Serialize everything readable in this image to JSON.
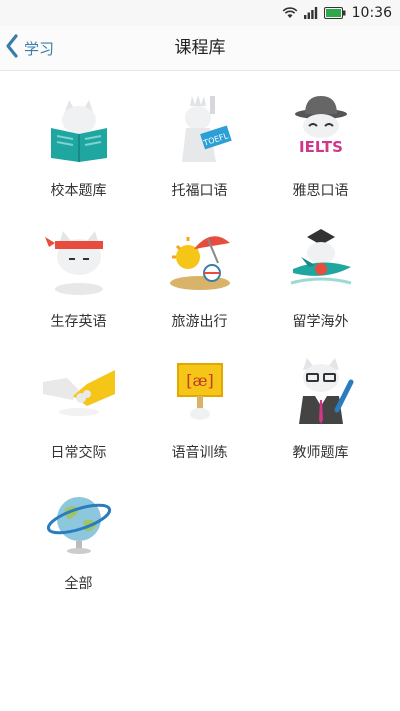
{
  "status_bar": {
    "time": "10:36"
  },
  "header": {
    "back_label": "学习",
    "title": "课程库"
  },
  "courses": [
    {
      "label": "校本题库",
      "icon": "book-cat-icon"
    },
    {
      "label": "托福口语",
      "icon": "statue-of-liberty-toefl-icon",
      "badge": "TOEFL"
    },
    {
      "label": "雅思口语",
      "icon": "bowler-hat-ielts-icon",
      "badge": "IELTS"
    },
    {
      "label": "生存英语",
      "icon": "headband-cat-icon"
    },
    {
      "label": "旅游出行",
      "icon": "beach-umbrella-icon"
    },
    {
      "label": "留学海外",
      "icon": "graduation-airplane-icon"
    },
    {
      "label": "日常交际",
      "icon": "handshake-icon"
    },
    {
      "label": "语音训练",
      "icon": "phonetic-sign-icon",
      "badge": "[æ]"
    },
    {
      "label": "教师题库",
      "icon": "teacher-cat-icon"
    },
    {
      "label": "全部",
      "icon": "globe-icon"
    }
  ],
  "colors": {
    "accent": "#3a7ea8",
    "teal": "#1fa6a0",
    "pink": "#d0368a",
    "red": "#e74c3c",
    "yellow": "#f5c518"
  }
}
